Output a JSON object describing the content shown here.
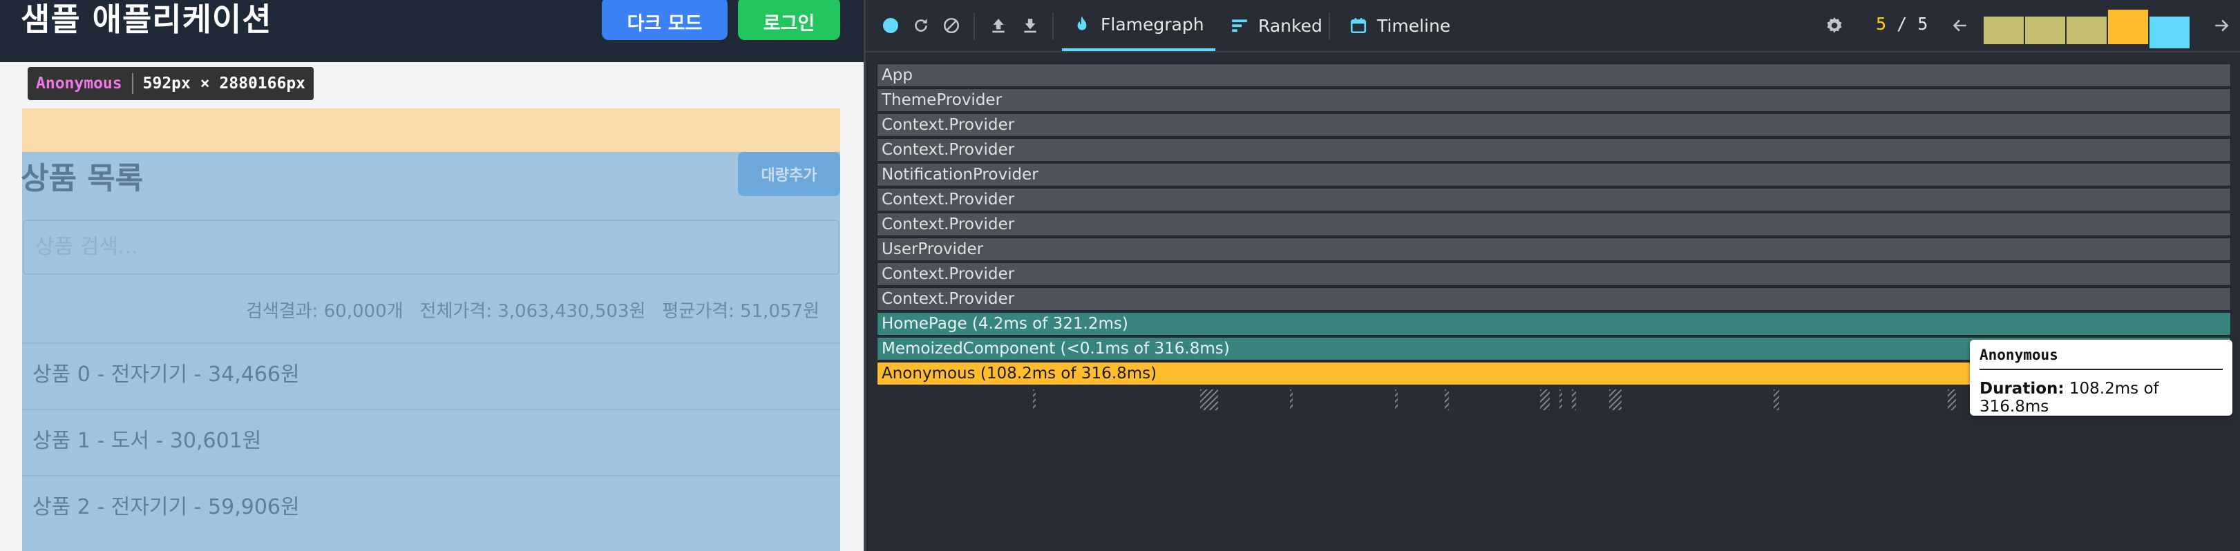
{
  "app": {
    "title": "샘플 애플리케이션",
    "dark_mode_label": "다크 모드",
    "login_label": "로그인",
    "inspect": {
      "component": "Anonymous",
      "size": "592px × 2880166px"
    },
    "list_title": "상품 목록",
    "bulk_add_label": "대량추가",
    "search_placeholder": "상품 검색...",
    "stats": {
      "count": "검색결과: 60,000개",
      "total": "전체가격: 3,063,430,503원",
      "average": "평균가격: 51,057원"
    },
    "products": [
      "상품 0 - 전자기기 - 34,466원",
      "상품 1 - 도서 - 30,601원",
      "상품 2 - 전자기기 - 59,906원"
    ]
  },
  "devtools": {
    "tabs": [
      {
        "label": "Flamegraph",
        "icon": "flame-icon",
        "active": true
      },
      {
        "label": "Ranked",
        "icon": "ranked-icon",
        "active": false
      },
      {
        "label": "Timeline",
        "icon": "timeline-icon",
        "active": false
      }
    ],
    "commit": {
      "current": "5",
      "total": "/ 5"
    },
    "commits": [
      {
        "color": "#c5bd6f",
        "level": 0.8,
        "selected": false
      },
      {
        "color": "#c5bd6f",
        "level": 0.8,
        "selected": false
      },
      {
        "color": "#c5bd6f",
        "level": 0.8,
        "selected": false
      },
      {
        "color": "#ffbd2e",
        "level": 1.0,
        "selected": false
      },
      {
        "color": "#61dafb",
        "level": 0.8,
        "selected": true
      }
    ],
    "flame_rows": [
      {
        "label": "App",
        "style": "grey"
      },
      {
        "label": "ThemeProvider",
        "style": "grey"
      },
      {
        "label": "Context.Provider",
        "style": "grey"
      },
      {
        "label": "Context.Provider",
        "style": "grey"
      },
      {
        "label": "NotificationProvider",
        "style": "grey"
      },
      {
        "label": "Context.Provider",
        "style": "grey"
      },
      {
        "label": "Context.Provider",
        "style": "grey"
      },
      {
        "label": "UserProvider",
        "style": "grey"
      },
      {
        "label": "Context.Provider",
        "style": "grey"
      },
      {
        "label": "Context.Provider",
        "style": "grey"
      },
      {
        "label": "HomePage (4.2ms of 321.2ms)",
        "style": "teal"
      },
      {
        "label": "MemoizedComponent (<0.1ms of 316.8ms)",
        "style": "teal"
      },
      {
        "label": "Anonymous (108.2ms of 316.8ms)",
        "style": "yellow"
      }
    ],
    "tooltip": {
      "title": "Anonymous",
      "duration_label": "Duration:",
      "duration_value": "108.2ms of 316.8ms"
    }
  }
}
